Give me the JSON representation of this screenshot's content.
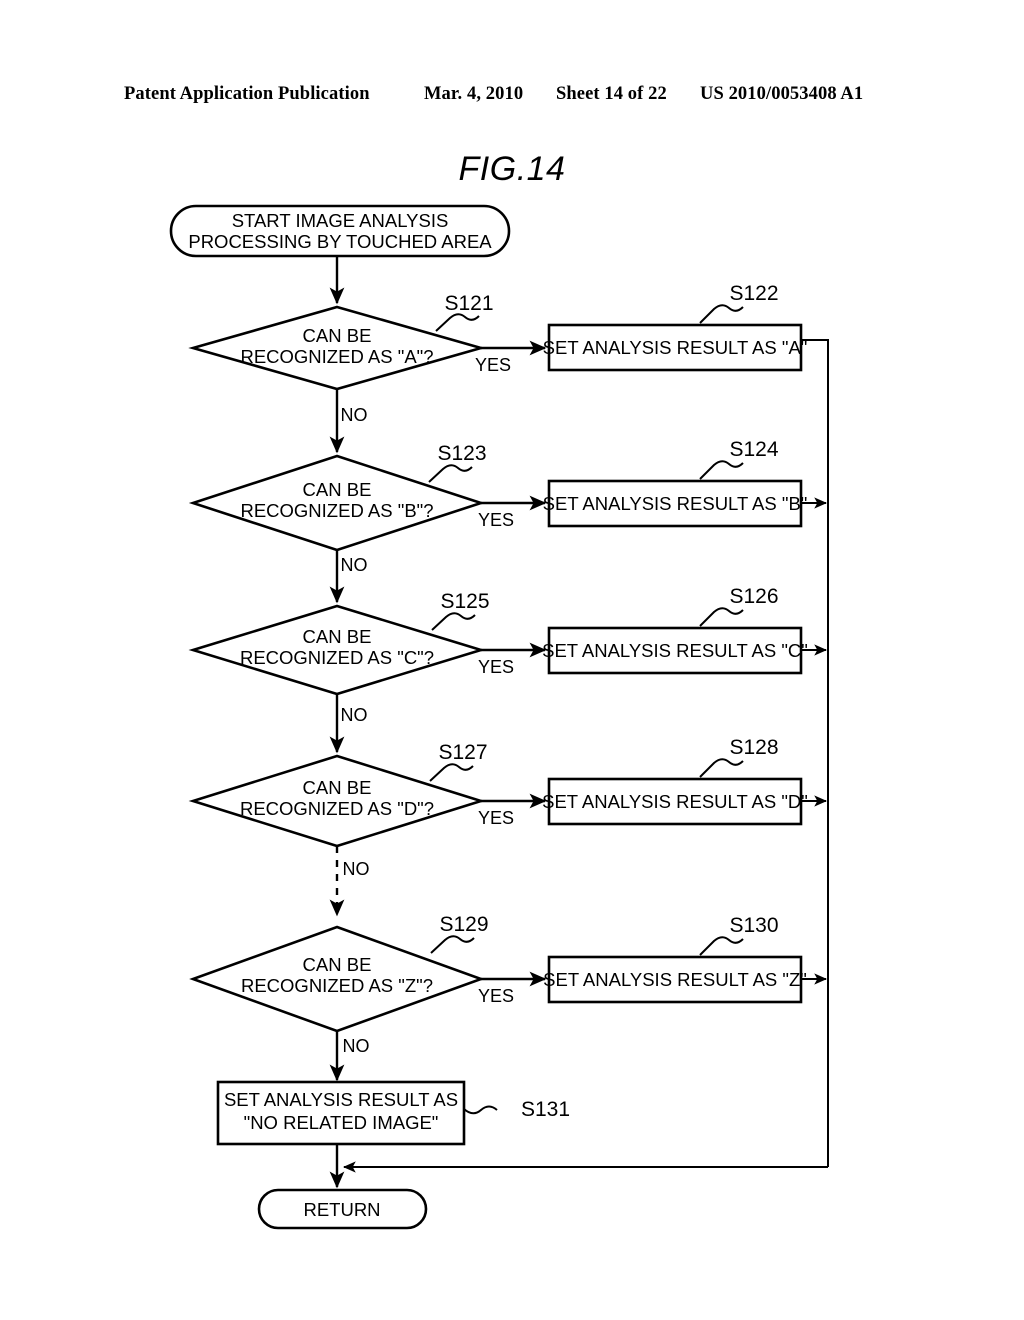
{
  "header": {
    "publication": "Patent Application Publication",
    "date": "Mar. 4, 2010",
    "sheet": "Sheet 14 of 22",
    "number": "US 2010/0053408 A1"
  },
  "figure": {
    "title": "FIG.14"
  },
  "flowchart": {
    "start": {
      "line1": "START IMAGE ANALYSIS",
      "line2": "PROCESSING BY TOUCHED AREA"
    },
    "end": {
      "label": "RETURN"
    },
    "decisions": [
      {
        "step": "S121",
        "line1": "CAN BE",
        "line2": "RECOGNIZED AS \"A\"?",
        "yes": "YES",
        "no": "NO"
      },
      {
        "step": "S123",
        "line1": "CAN BE",
        "line2": "RECOGNIZED AS \"B\"?",
        "yes": "YES",
        "no": "NO"
      },
      {
        "step": "S125",
        "line1": "CAN BE",
        "line2": "RECOGNIZED AS \"C\"?",
        "yes": "YES",
        "no": "NO"
      },
      {
        "step": "S127",
        "line1": "CAN BE",
        "line2": "RECOGNIZED AS \"D\"?",
        "yes": "YES",
        "no": "NO"
      },
      {
        "step": "S129",
        "line1": "CAN BE",
        "line2": "RECOGNIZED AS \"Z\"?",
        "yes": "YES",
        "no": "NO"
      }
    ],
    "processes": [
      {
        "step": "S122",
        "label": "SET ANALYSIS RESULT AS \"A\""
      },
      {
        "step": "S124",
        "label": "SET ANALYSIS RESULT AS \"B\""
      },
      {
        "step": "S126",
        "label": "SET ANALYSIS RESULT AS \"C\""
      },
      {
        "step": "S128",
        "label": "SET ANALYSIS RESULT AS \"D\""
      },
      {
        "step": "S130",
        "label": "SET ANALYSIS RESULT AS \"Z\""
      }
    ],
    "final_process": {
      "step": "S131",
      "line1": "SET ANALYSIS RESULT AS",
      "line2": "\"NO RELATED IMAGE\""
    },
    "colors": {
      "ink": "#000000",
      "paper": "#ffffff"
    }
  }
}
